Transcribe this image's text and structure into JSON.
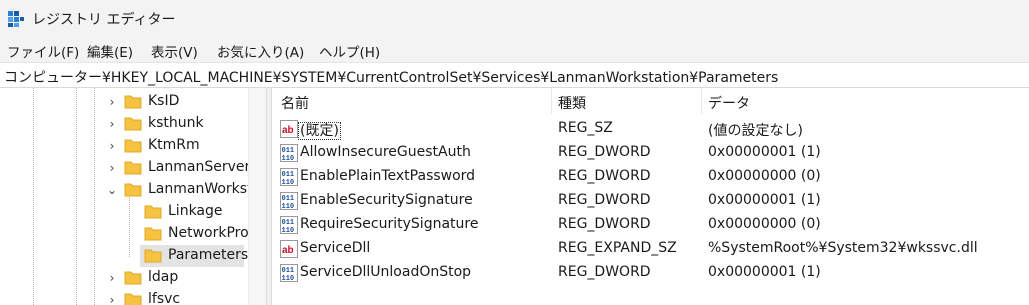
{
  "window": {
    "title": "レジストリ エディター"
  },
  "menu": [
    {
      "label": "ファイル(F)"
    },
    {
      "label": "編集(E)"
    },
    {
      "label": "表示(V)"
    },
    {
      "label": "お気に入り(A)"
    },
    {
      "label": "ヘルプ(H)"
    }
  ],
  "address": {
    "path": "コンピューター¥HKEY_LOCAL_MACHINE¥SYSTEM¥CurrentControlSet¥Services¥LanmanWorkstation¥Parameters"
  },
  "tree": [
    {
      "label": "KsID",
      "chevron": "›"
    },
    {
      "label": "ksthunk",
      "chevron": "›"
    },
    {
      "label": "KtmRm",
      "chevron": "›"
    },
    {
      "label": "LanmanServer",
      "chevron": "›"
    },
    {
      "label": "LanmanWorkst",
      "chevron": "⌄"
    },
    {
      "label": "Linkage"
    },
    {
      "label": "NetworkPro"
    },
    {
      "label": "Parameters",
      "selected": true
    },
    {
      "label": "ldap",
      "chevron": "›"
    },
    {
      "label": "lfsvc",
      "chevron": "›"
    }
  ],
  "columns": {
    "name": "名前",
    "type": "種類",
    "data": "データ"
  },
  "values": [
    {
      "icon": "string-value-icon",
      "name": "(既定)",
      "type": "REG_SZ",
      "data": "(値の設定なし)"
    },
    {
      "icon": "binary-value-icon",
      "name": "AllowInsecureGuestAuth",
      "type": "REG_DWORD",
      "data": "0x00000001 (1)"
    },
    {
      "icon": "binary-value-icon",
      "name": "EnablePlainTextPassword",
      "type": "REG_DWORD",
      "data": "0x00000000 (0)"
    },
    {
      "icon": "binary-value-icon",
      "name": "EnableSecuritySignature",
      "type": "REG_DWORD",
      "data": "0x00000001 (1)"
    },
    {
      "icon": "binary-value-icon",
      "name": "RequireSecuritySignature",
      "type": "REG_DWORD",
      "data": "0x00000000 (0)"
    },
    {
      "icon": "string-value-icon",
      "name": "ServiceDll",
      "type": "REG_EXPAND_SZ",
      "data": "%SystemRoot%¥System32¥wkssvc.dll"
    },
    {
      "icon": "binary-value-icon",
      "name": "ServiceDllUnloadOnStop",
      "type": "REG_DWORD",
      "data": "0x00000001 (1)"
    }
  ],
  "colors": {
    "folder": "#f5c242",
    "folder_dark": "#e0a823",
    "selection": "#e3e3e3",
    "string_icon": "#c8102e",
    "binary_icon": "#1f4e9c"
  }
}
